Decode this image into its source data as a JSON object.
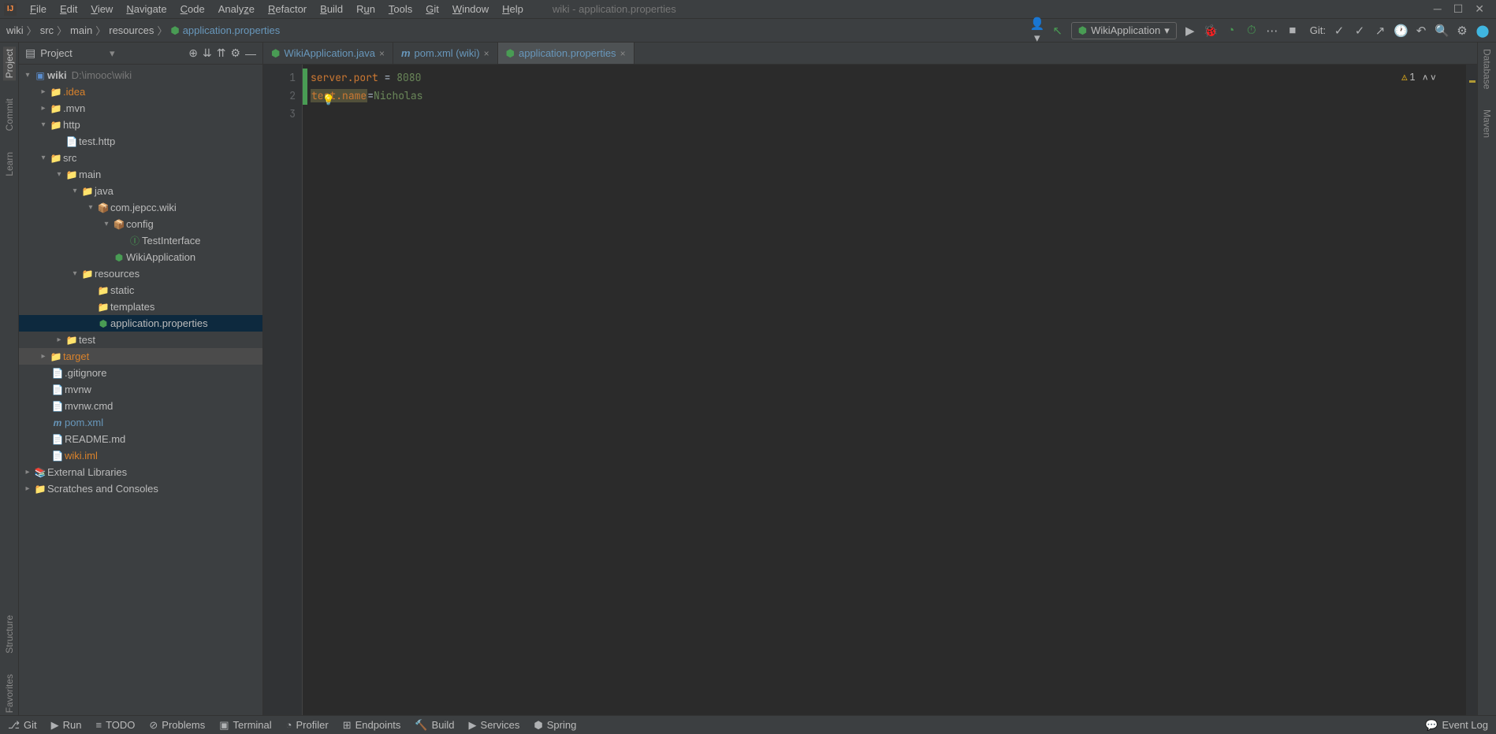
{
  "title": "wiki - application.properties",
  "menu": [
    "File",
    "Edit",
    "View",
    "Navigate",
    "Code",
    "Analyze",
    "Refactor",
    "Build",
    "Run",
    "Tools",
    "Git",
    "Window",
    "Help"
  ],
  "breadcrumb": [
    "wiki",
    "src",
    "main",
    "resources",
    "application.properties"
  ],
  "runConfig": "WikiApplication",
  "gitLabel": "Git:",
  "leftGutter": [
    "Project",
    "Commit",
    "Learn"
  ],
  "leftGutterBottom": [
    "Structure",
    "Favorites"
  ],
  "rightGutter": [
    "Database",
    "Maven"
  ],
  "projectPanel": {
    "title": "Project"
  },
  "tree": {
    "root": {
      "name": "wiki",
      "path": "D:\\imooc\\wiki"
    },
    "idea": ".idea",
    "mvn": ".mvn",
    "http": "http",
    "testhttp": "test.http",
    "src": "src",
    "main": "main",
    "java": "java",
    "pkg": "com.jepcc.wiki",
    "config": "config",
    "testinterface": "TestInterface",
    "wikiapp": "WikiApplication",
    "resources": "resources",
    "static": "static",
    "templates": "templates",
    "appprops": "application.properties",
    "test": "test",
    "target": "target",
    "gitignore": ".gitignore",
    "mvnw": "mvnw",
    "mvnwcmd": "mvnw.cmd",
    "pomxml": "pom.xml",
    "readme": "README.md",
    "wikiiml": "wiki.iml",
    "extlib": "External Libraries",
    "scratches": "Scratches and Consoles"
  },
  "tabs": [
    {
      "label": "WikiApplication.java",
      "icon": "spring"
    },
    {
      "label": "pom.xml (wiki)",
      "icon": "maven"
    },
    {
      "label": "application.properties",
      "icon": "spring",
      "active": true
    }
  ],
  "editor": {
    "line1": {
      "key": "server.port",
      "eq": " = ",
      "val": "8080"
    },
    "line2": {
      "prefix": "te",
      "warnL": "s",
      "mid": "t.name",
      "eq": "=",
      "val": "Nicholas"
    },
    "lines": [
      "1",
      "2",
      "3"
    ],
    "warnCount": "1"
  },
  "statusbar": {
    "git": "Git",
    "run": "Run",
    "todo": "TODO",
    "problems": "Problems",
    "terminal": "Terminal",
    "profiler": "Profiler",
    "endpoints": "Endpoints",
    "build": "Build",
    "services": "Services",
    "spring": "Spring",
    "eventlog": "Event Log"
  }
}
